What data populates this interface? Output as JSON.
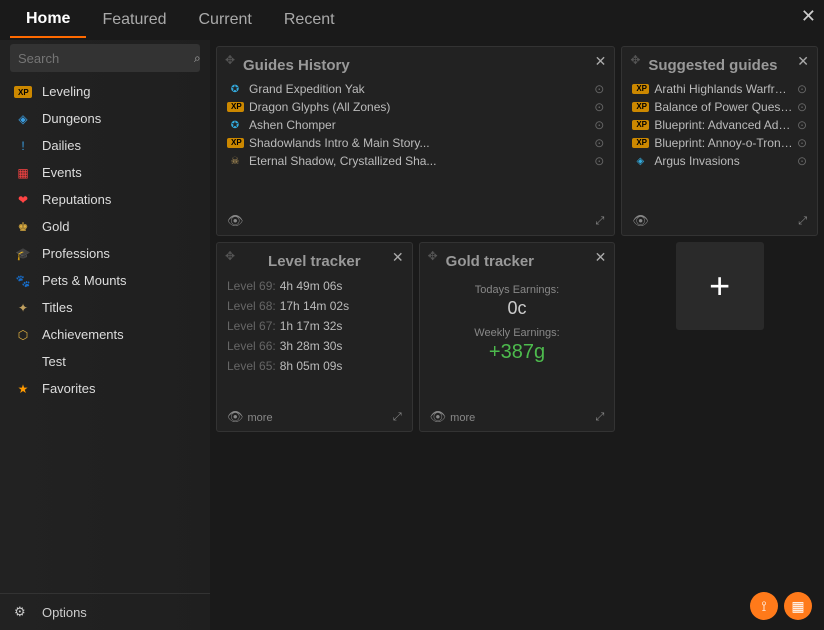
{
  "tabs": [
    "Home",
    "Featured",
    "Current",
    "Recent"
  ],
  "active_tab": 0,
  "search": {
    "placeholder": "Search"
  },
  "sidebar": [
    {
      "icon": "XP",
      "icon_class": "xp-badge",
      "label": "Leveling"
    },
    {
      "icon": "◈",
      "icon_class": "c-blue",
      "label": "Dungeons"
    },
    {
      "icon": "!",
      "icon_class": "c-blue",
      "label": "Dailies"
    },
    {
      "icon": "▦",
      "icon_class": "c-red",
      "label": "Events"
    },
    {
      "icon": "❤",
      "icon_class": "c-red",
      "label": "Reputations"
    },
    {
      "icon": "♚",
      "icon_class": "c-gold",
      "label": "Gold"
    },
    {
      "icon": "🎓",
      "icon_class": "c-grey",
      "label": "Professions"
    },
    {
      "icon": "🐾",
      "icon_class": "c-teal",
      "label": "Pets & Mounts"
    },
    {
      "icon": "✦",
      "icon_class": "c-tan",
      "label": "Titles"
    },
    {
      "icon": "⬡",
      "icon_class": "c-gold",
      "label": "Achievements"
    },
    {
      "icon": "",
      "icon_class": "",
      "label": "Test"
    },
    {
      "icon": "★",
      "icon_class": "c-orange",
      "label": "Favorites"
    }
  ],
  "options_label": "Options",
  "history": {
    "title": "Guides History",
    "items": [
      {
        "i": "✪",
        "ic": "c-teal",
        "t": "Grand Expedition Yak"
      },
      {
        "i": "XP",
        "ic": "xp-badge",
        "t": "Dragon Glyphs (All Zones)"
      },
      {
        "i": "✪",
        "ic": "c-teal",
        "t": "Ashen Chomper"
      },
      {
        "i": "XP",
        "ic": "xp-badge",
        "t": "Shadowlands Intro & Main Story..."
      },
      {
        "i": "☠",
        "ic": "c-tan",
        "t": "Eternal Shadow, Crystallized Sha..."
      }
    ]
  },
  "suggested": {
    "title": "Suggested guides",
    "items": [
      {
        "i": "XP",
        "ic": "xp-badge",
        "t": "Arathi Highlands Warfront Extra..."
      },
      {
        "i": "XP",
        "ic": "xp-badge",
        "t": "Balance of Power Questline"
      },
      {
        "i": "XP",
        "ic": "xp-badge",
        "t": "Blueprint: Advanced Adventurer..."
      },
      {
        "i": "XP",
        "ic": "xp-badge",
        "t": "Blueprint: Annoy-o-Tron Gang"
      },
      {
        "i": "◈",
        "ic": "c-teal",
        "t": "Argus Invasions"
      }
    ]
  },
  "level_tracker": {
    "title": "Level tracker",
    "rows": [
      {
        "lv": "Level 69:",
        "time": "4h 49m 06s"
      },
      {
        "lv": "Level 68:",
        "time": "17h 14m 02s"
      },
      {
        "lv": "Level 67:",
        "time": "1h 17m 32s"
      },
      {
        "lv": "Level 66:",
        "time": "3h 28m 30s"
      },
      {
        "lv": "Level 65:",
        "time": "8h 05m 09s"
      }
    ],
    "more": "more"
  },
  "gold_tracker": {
    "title": "Gold tracker",
    "today_label": "Todays Earnings:",
    "today_value": "0c",
    "weekly_label": "Weekly Earnings:",
    "weekly_value": "+387g",
    "more": "more"
  }
}
